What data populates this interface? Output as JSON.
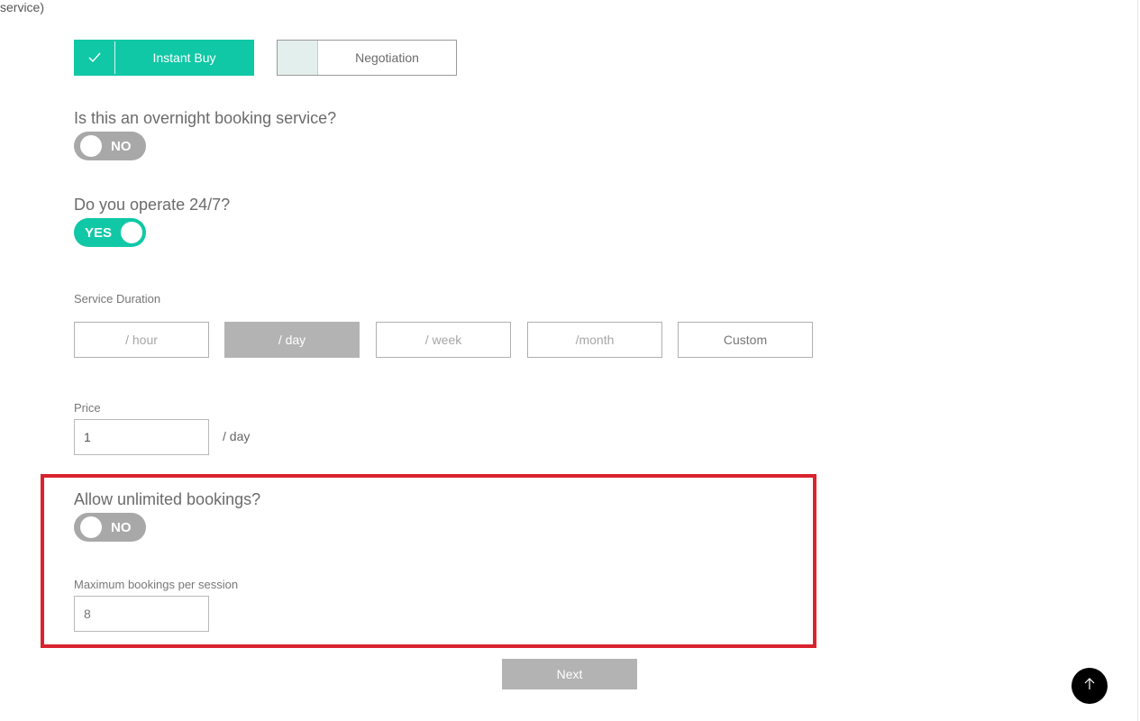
{
  "top_cut_text": "service)",
  "booking_type": {
    "options": [
      {
        "label": "Instant Buy",
        "selected": true
      },
      {
        "label": "Negotiation",
        "selected": false
      }
    ]
  },
  "overnight": {
    "question": "Is this an overnight booking service?",
    "toggle_text": "NO",
    "value": false
  },
  "operate_247": {
    "question": "Do you operate 24/7?",
    "toggle_text": "YES",
    "value": true
  },
  "service_duration": {
    "label": "Service Duration",
    "options": [
      "/ hour",
      "/ day",
      "/ week",
      "/month",
      "Custom"
    ],
    "selected": "/ day"
  },
  "price": {
    "label": "Price",
    "value": "1",
    "unit": "/ day"
  },
  "unlimited": {
    "question": "Allow unlimited bookings?",
    "toggle_text": "NO",
    "value": false
  },
  "max_bookings": {
    "label": "Maximum bookings per session",
    "placeholder": "8"
  },
  "next_label": "Next",
  "colors": {
    "accent": "#10c8a6",
    "highlight": "#d9232e",
    "disabled": "#b3b3b3"
  },
  "icons": {
    "check": "check-icon",
    "scroll_top": "arrow-up-icon"
  }
}
